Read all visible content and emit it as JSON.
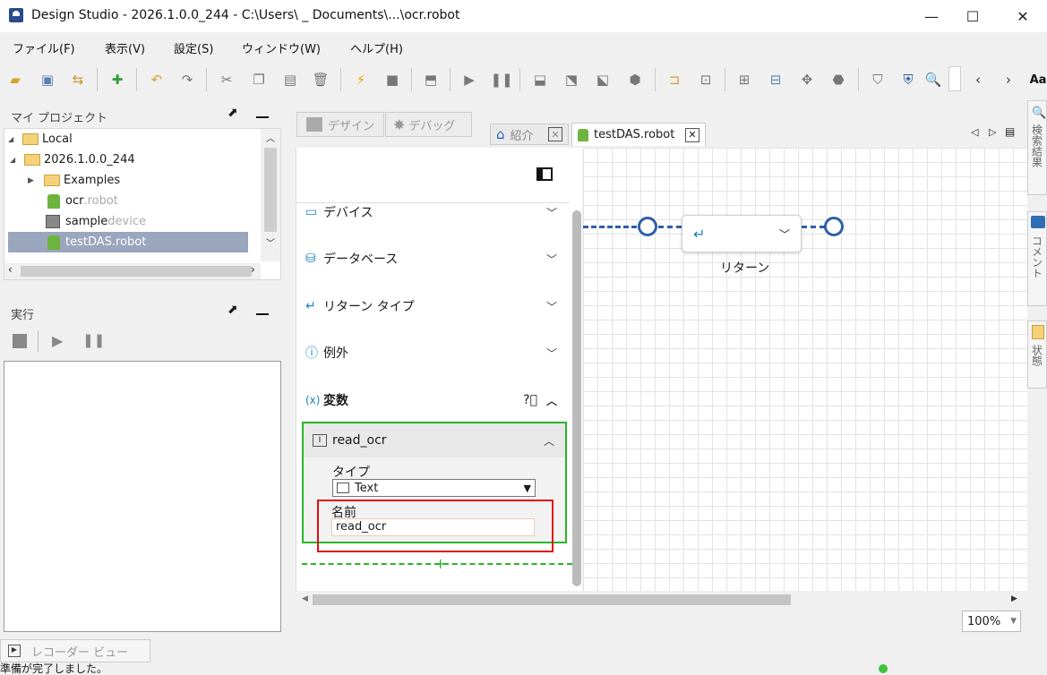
{
  "window": {
    "title": "Design Studio - 2026.1.0.0_244 - C:\\Users\\ _ Documents\\...\\ocr.robot",
    "minimize": "—",
    "maximize": "☐",
    "close": "✕"
  },
  "menu": [
    "ファイル(F)",
    "表示(V)",
    "設定(S)",
    "ウィンドウ(W)",
    "ヘルプ(H)"
  ],
  "toolbar": {
    "font_label": "Aa"
  },
  "project_panel": {
    "title": "マイ プロジェクト",
    "tree": [
      {
        "label": "Local",
        "ext": ""
      },
      {
        "label": "2026.1.0.0_244",
        "ext": ""
      },
      {
        "label": "Examples",
        "ext": ""
      },
      {
        "label": "ocr",
        "ext": ".robot"
      },
      {
        "label": "sample",
        "ext": " device"
      },
      {
        "label": "testDAS.robot",
        "ext": ""
      }
    ]
  },
  "exec_panel": {
    "title": "実行"
  },
  "mode_tabs": {
    "design": "デザイン",
    "debug": "デバッグ"
  },
  "editor_tabs": {
    "intro": "紹介",
    "robot": "testDAS.robot"
  },
  "palette": {
    "sections": [
      "デバイス",
      "データベース",
      "リターン タイプ",
      "例外",
      "変数"
    ],
    "variable": {
      "name": "read_ocr",
      "type_label": "タイプ",
      "type_value": "Text",
      "name_label": "名前",
      "name_value": "read_ocr"
    }
  },
  "canvas": {
    "step_label": "リターン"
  },
  "zoom": "100%",
  "bottom": {
    "recorder_tab": "レコーダー ビュー",
    "status": "準備が完了しました。"
  },
  "right_tabs": {
    "search": "検索結果",
    "comment": "コメント",
    "state": "状態"
  },
  "colors": {
    "accent": "#2f6db5",
    "highlight_green": "#2ab52a",
    "highlight_red": "#e01010",
    "selection": "#9aa6bd"
  }
}
